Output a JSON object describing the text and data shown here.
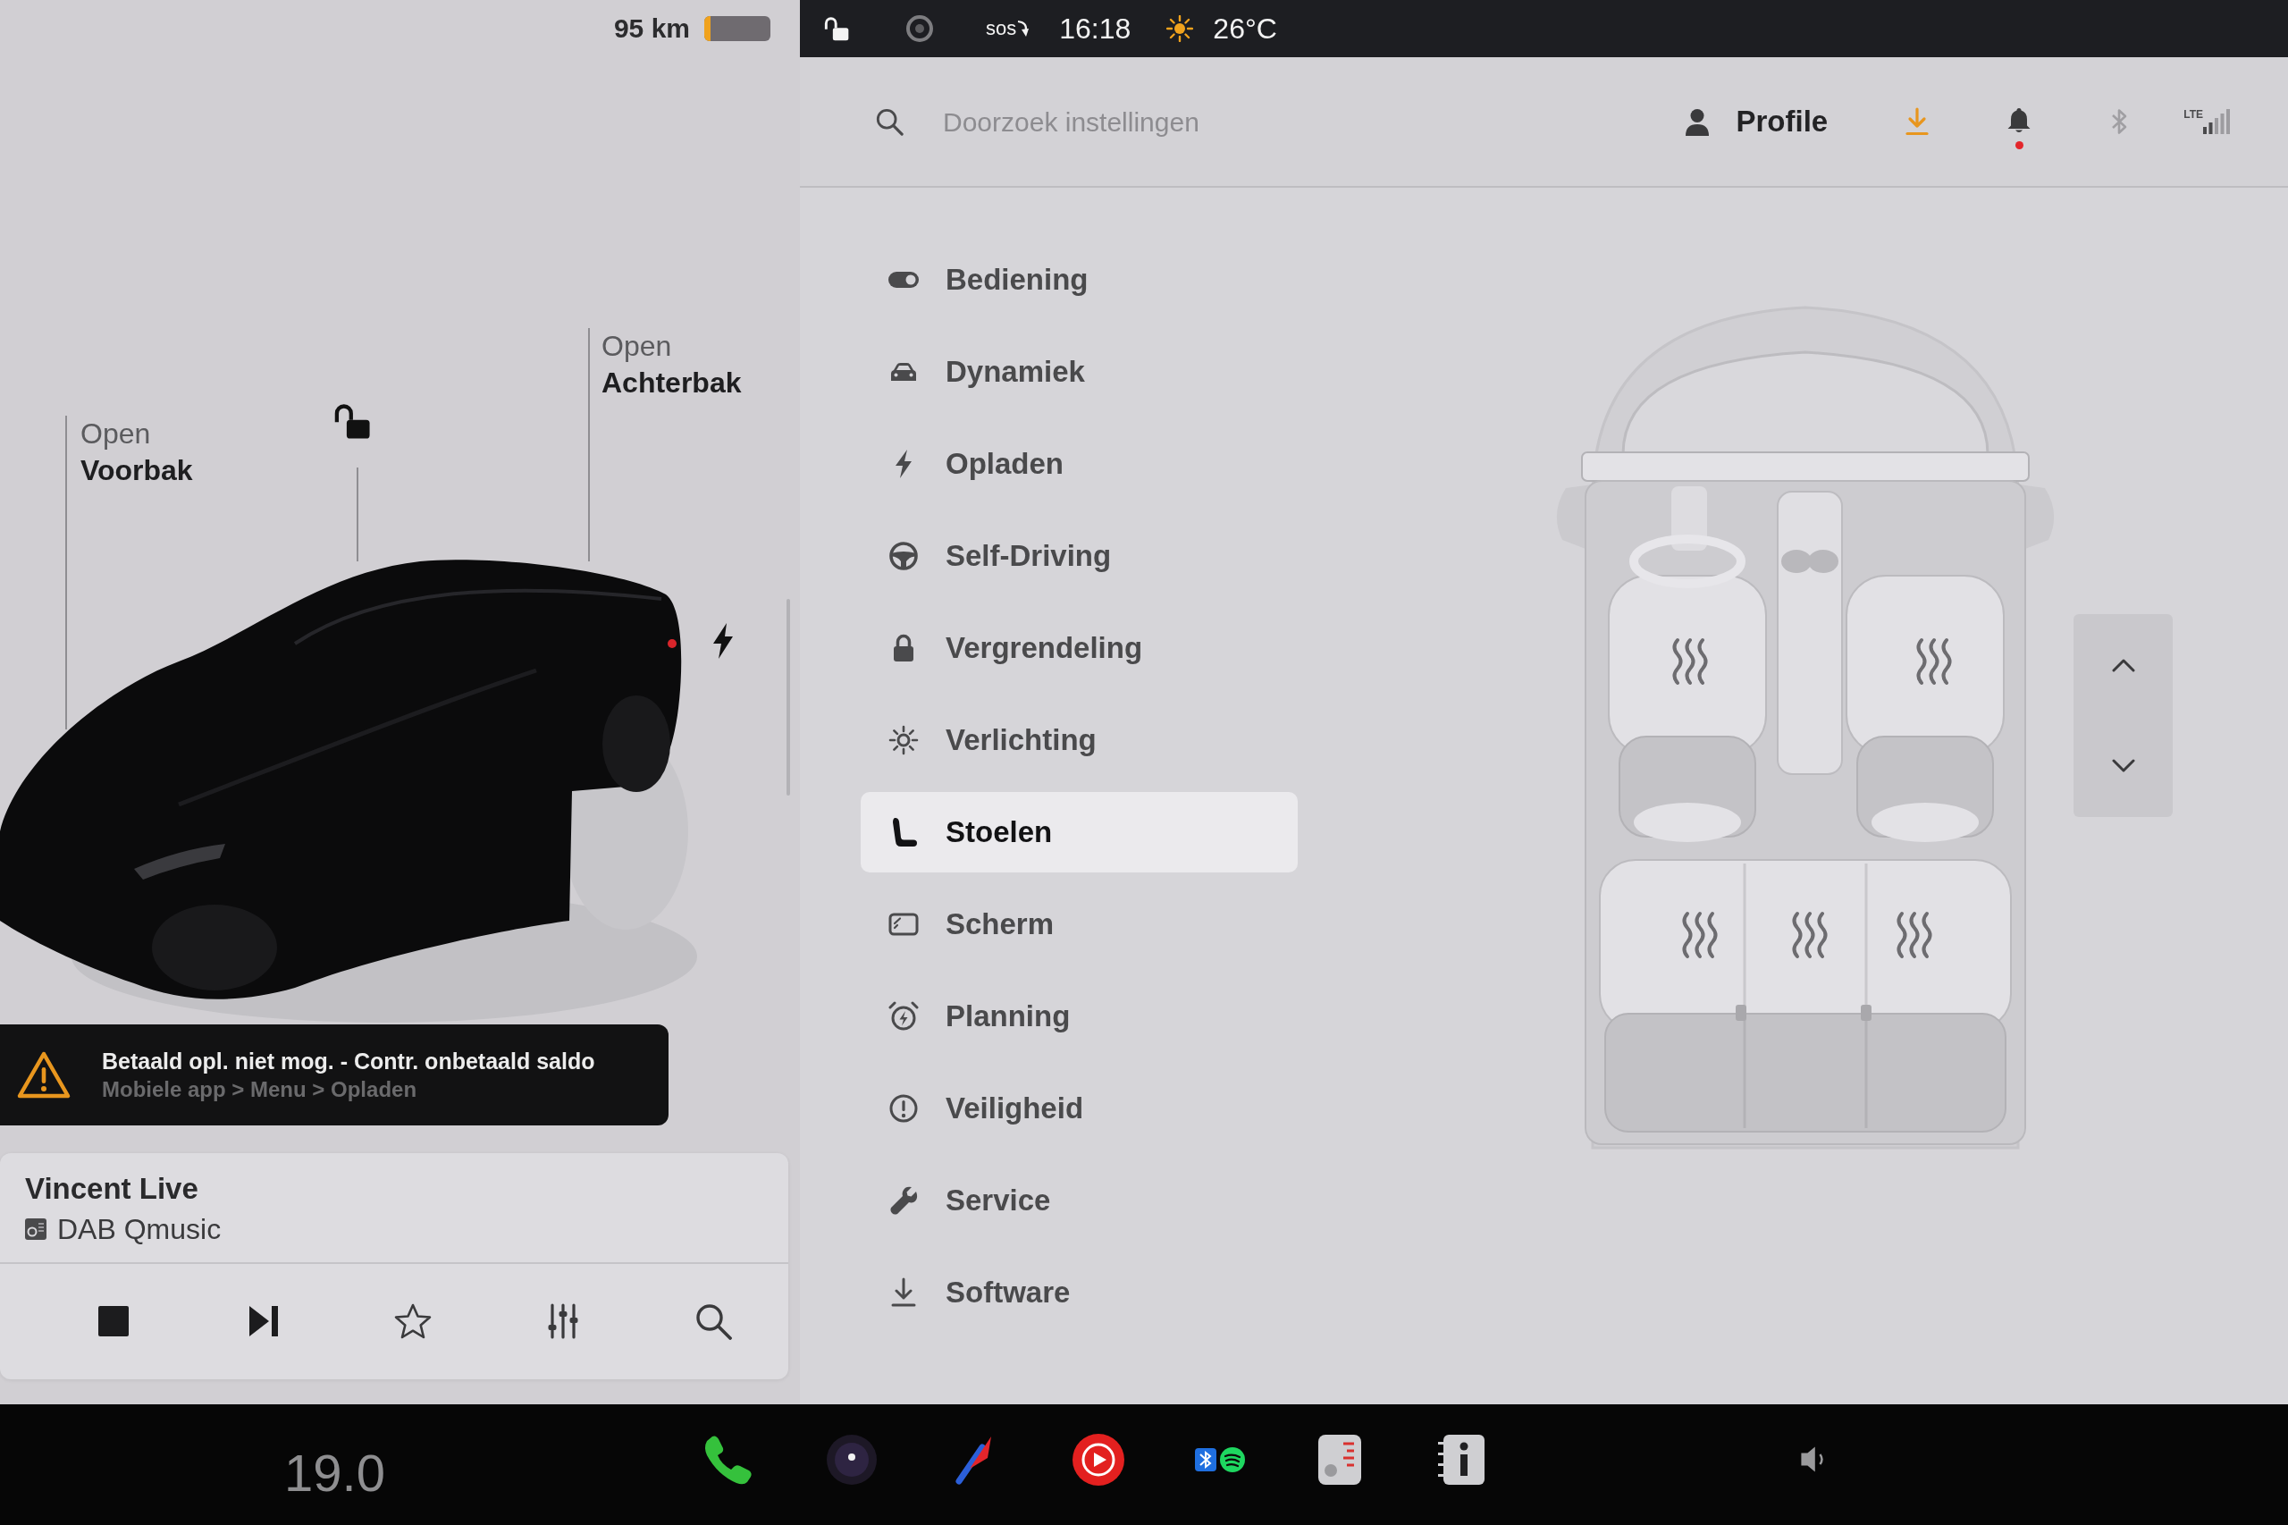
{
  "status_left": {
    "range": "95 km",
    "battery": {
      "level": 0.1
    }
  },
  "vehicle": {
    "locked": false
  },
  "car_view": {
    "openers": [
      {
        "kind": "frunk",
        "action": "Open",
        "target": "Voorbak"
      },
      {
        "kind": "trunk",
        "action": "Open",
        "target": "Achterbak"
      }
    ]
  },
  "alert": {
    "title": "Betaald opl. niet mog. - Contr. onbetaald saldo",
    "detail": "Mobiele app > Menu > Opladen"
  },
  "media": {
    "title": "Vincent Live",
    "source": "DAB Qmusic"
  },
  "status_bar": {
    "sos": "sos",
    "time": "16:18",
    "temperature": "26°C"
  },
  "settings": {
    "search": {
      "placeholder": "Doorzoek instellingen"
    },
    "profile": "Profile",
    "notifications": {
      "unread": true
    },
    "network": "LTE",
    "menu": [
      {
        "label": "Bediening",
        "selected": false
      },
      {
        "label": "Dynamiek",
        "selected": false
      },
      {
        "label": "Opladen",
        "selected": false
      },
      {
        "label": "Self-Driving",
        "selected": false
      },
      {
        "label": "Vergrendeling",
        "selected": false
      },
      {
        "label": "Verlichting",
        "selected": false
      },
      {
        "label": "Stoelen",
        "selected": true
      },
      {
        "label": "Scherm",
        "selected": false
      },
      {
        "label": "Planning",
        "selected": false
      },
      {
        "label": "Veiligheid",
        "selected": false
      },
      {
        "label": "Service",
        "selected": false
      },
      {
        "label": "Software",
        "selected": false
      }
    ]
  },
  "taskbar": {
    "cabin_temperature": "19.0"
  }
}
